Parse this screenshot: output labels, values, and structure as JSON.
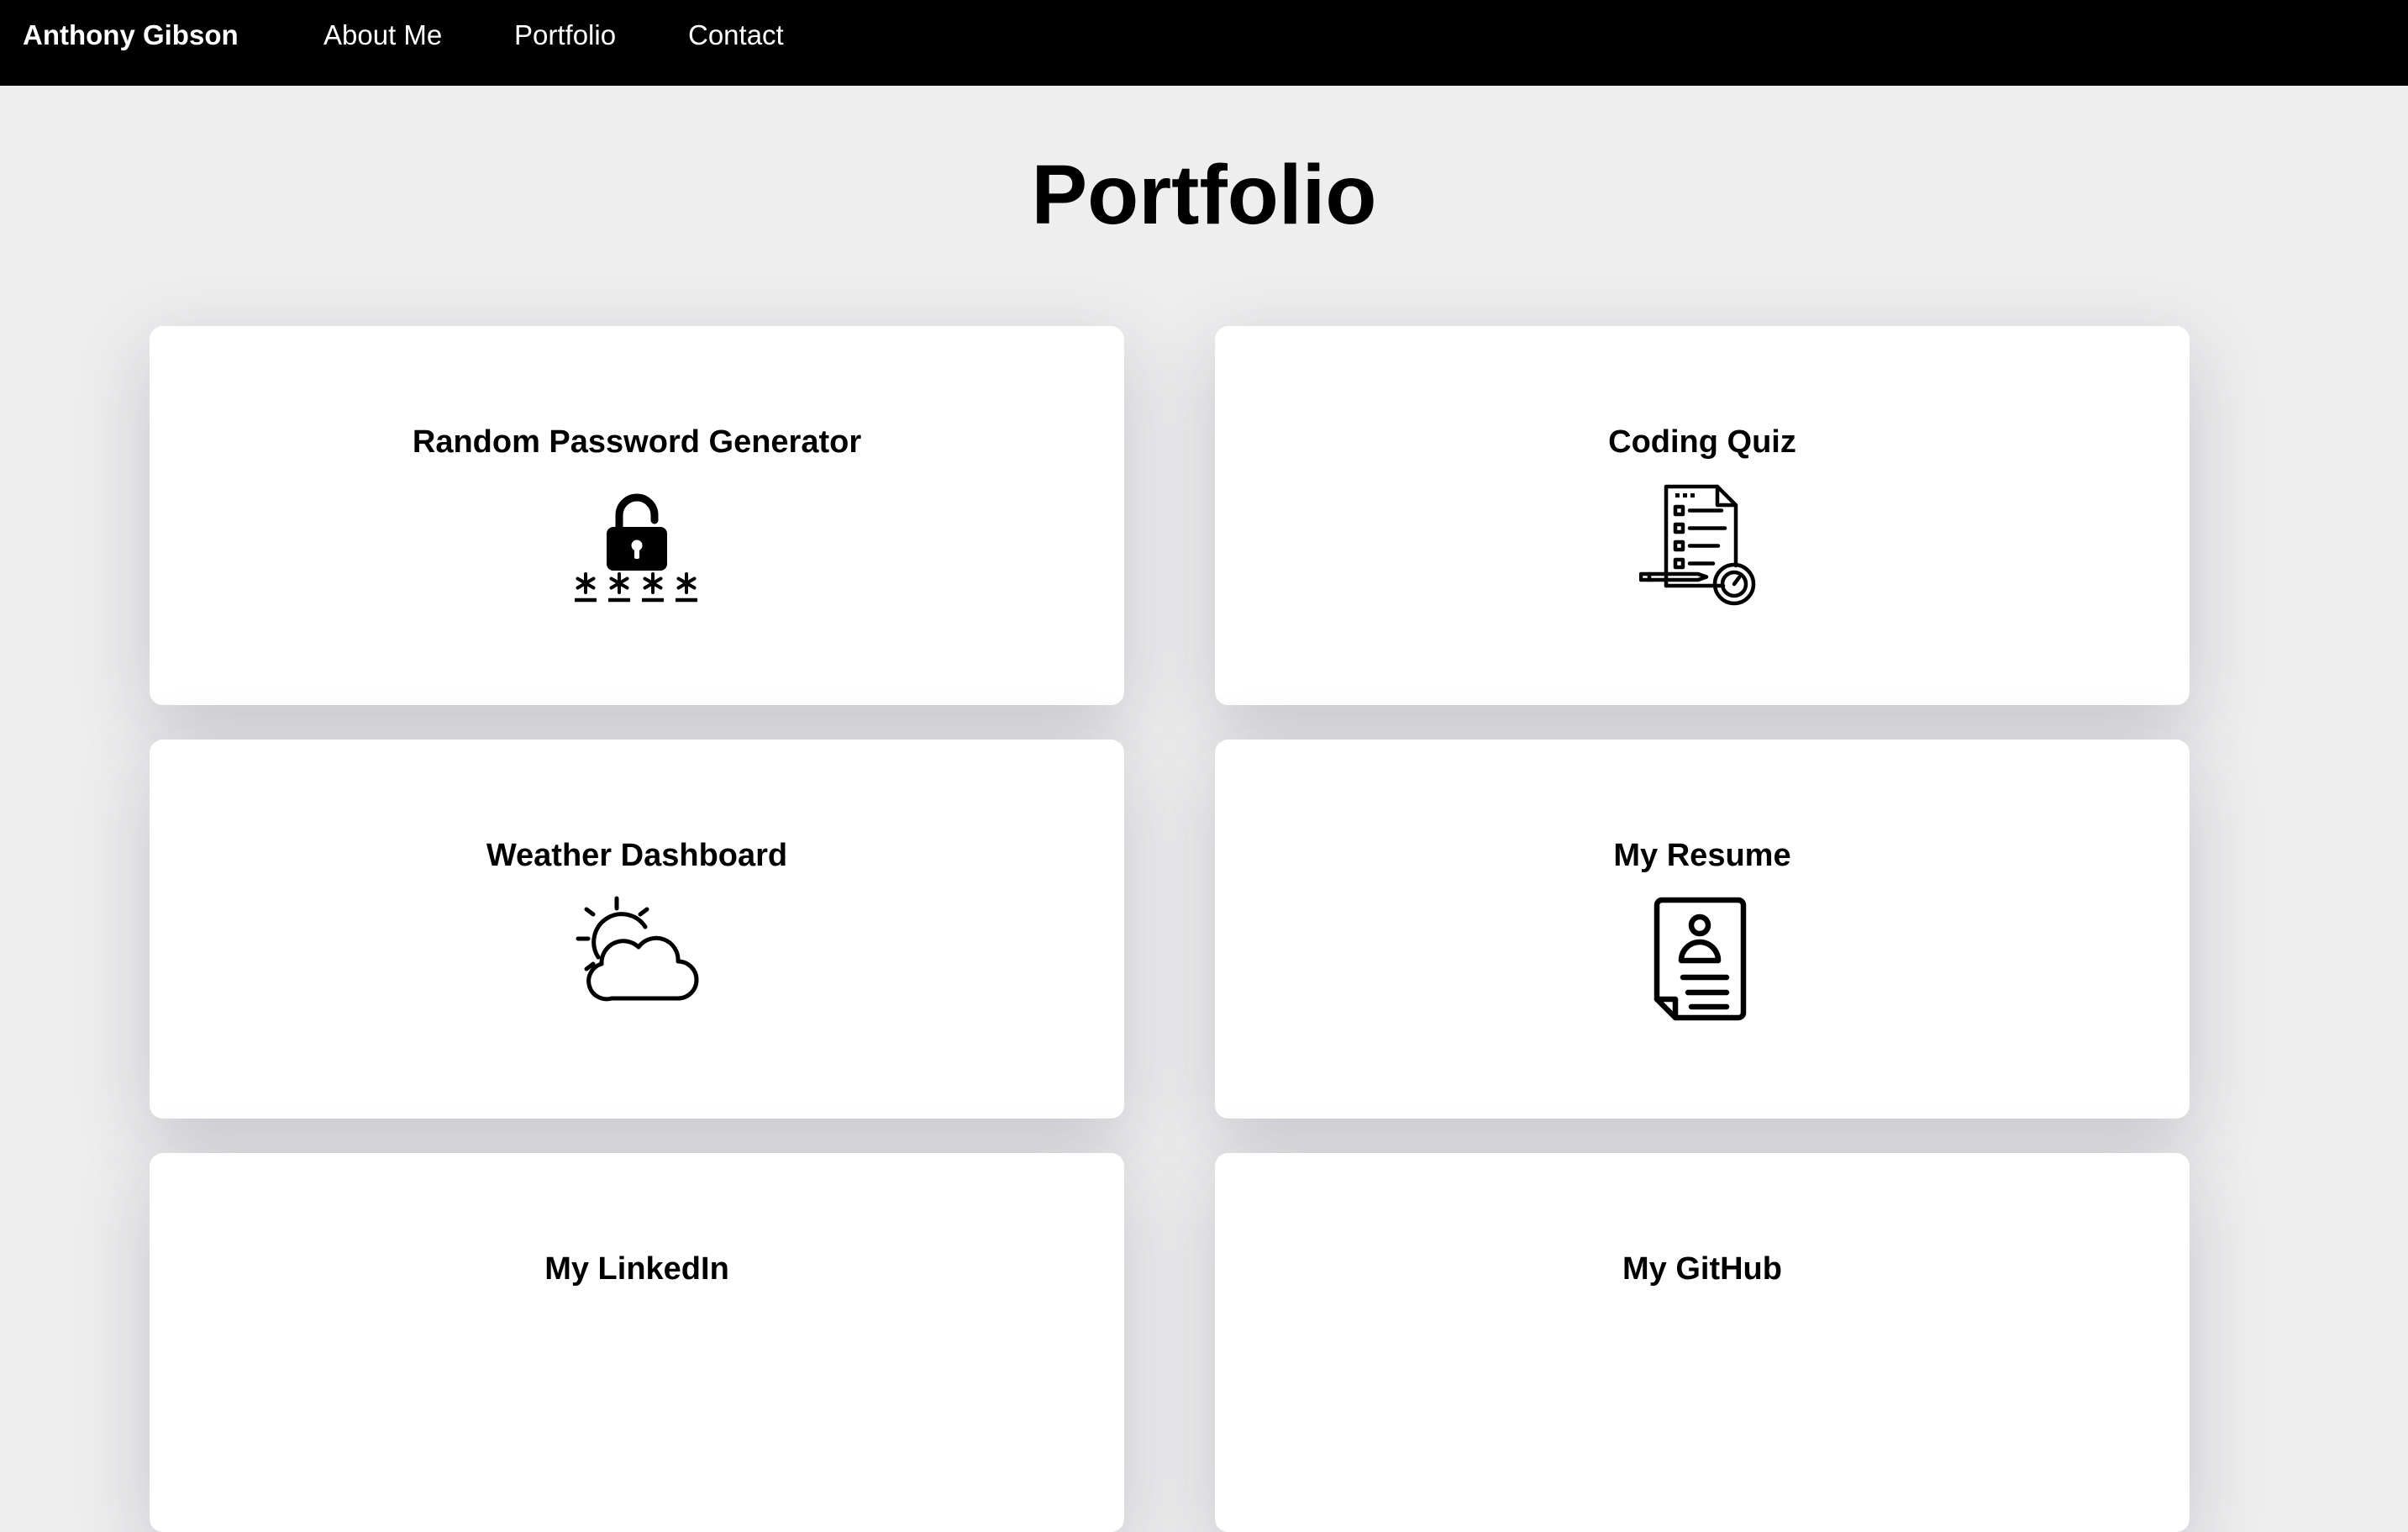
{
  "nav": {
    "brand": "Anthony Gibson",
    "links": [
      {
        "label": "About Me"
      },
      {
        "label": "Portfolio"
      },
      {
        "label": "Contact"
      }
    ]
  },
  "page": {
    "title": "Portfolio"
  },
  "projects": [
    {
      "title": "Random Password Generator",
      "icon": "lock-password-icon"
    },
    {
      "title": "Coding Quiz",
      "icon": "quiz-document-timer-icon"
    },
    {
      "title": "Weather Dashboard",
      "icon": "sun-cloud-icon"
    },
    {
      "title": "My Resume",
      "icon": "resume-profile-icon"
    },
    {
      "title": "My LinkedIn",
      "icon": ""
    },
    {
      "title": "My GitHub",
      "icon": ""
    }
  ],
  "colors": {
    "navbar_bg": "#000000",
    "page_bg": "#eeeeef",
    "card_bg": "#ffffff",
    "text": "#000000"
  }
}
